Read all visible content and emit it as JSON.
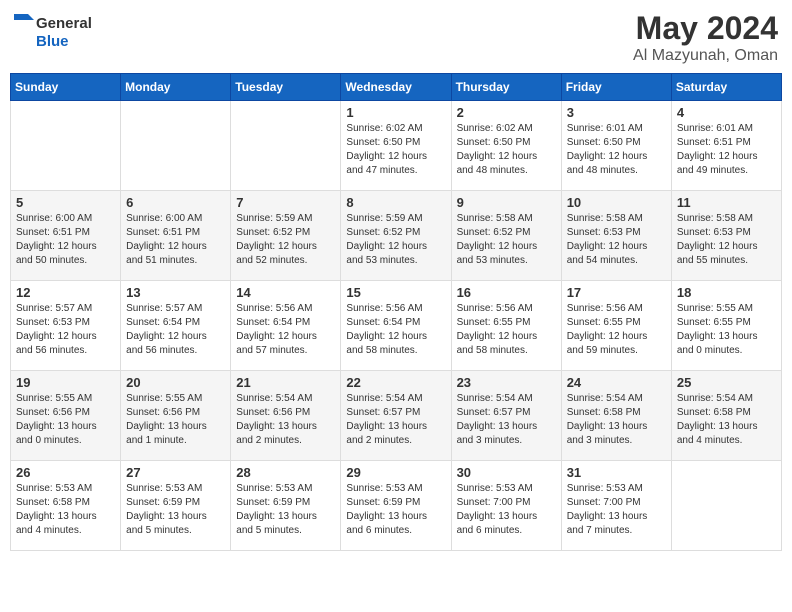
{
  "header": {
    "logo_general": "General",
    "logo_blue": "Blue",
    "title": "May 2024",
    "subtitle": "Al Mazyunah, Oman"
  },
  "days_of_week": [
    "Sunday",
    "Monday",
    "Tuesday",
    "Wednesday",
    "Thursday",
    "Friday",
    "Saturday"
  ],
  "weeks": [
    [
      {
        "day": "",
        "info": ""
      },
      {
        "day": "",
        "info": ""
      },
      {
        "day": "",
        "info": ""
      },
      {
        "day": "1",
        "info": "Sunrise: 6:02 AM\nSunset: 6:50 PM\nDaylight: 12 hours\nand 47 minutes."
      },
      {
        "day": "2",
        "info": "Sunrise: 6:02 AM\nSunset: 6:50 PM\nDaylight: 12 hours\nand 48 minutes."
      },
      {
        "day": "3",
        "info": "Sunrise: 6:01 AM\nSunset: 6:50 PM\nDaylight: 12 hours\nand 48 minutes."
      },
      {
        "day": "4",
        "info": "Sunrise: 6:01 AM\nSunset: 6:51 PM\nDaylight: 12 hours\nand 49 minutes."
      }
    ],
    [
      {
        "day": "5",
        "info": "Sunrise: 6:00 AM\nSunset: 6:51 PM\nDaylight: 12 hours\nand 50 minutes."
      },
      {
        "day": "6",
        "info": "Sunrise: 6:00 AM\nSunset: 6:51 PM\nDaylight: 12 hours\nand 51 minutes."
      },
      {
        "day": "7",
        "info": "Sunrise: 5:59 AM\nSunset: 6:52 PM\nDaylight: 12 hours\nand 52 minutes."
      },
      {
        "day": "8",
        "info": "Sunrise: 5:59 AM\nSunset: 6:52 PM\nDaylight: 12 hours\nand 53 minutes."
      },
      {
        "day": "9",
        "info": "Sunrise: 5:58 AM\nSunset: 6:52 PM\nDaylight: 12 hours\nand 53 minutes."
      },
      {
        "day": "10",
        "info": "Sunrise: 5:58 AM\nSunset: 6:53 PM\nDaylight: 12 hours\nand 54 minutes."
      },
      {
        "day": "11",
        "info": "Sunrise: 5:58 AM\nSunset: 6:53 PM\nDaylight: 12 hours\nand 55 minutes."
      }
    ],
    [
      {
        "day": "12",
        "info": "Sunrise: 5:57 AM\nSunset: 6:53 PM\nDaylight: 12 hours\nand 56 minutes."
      },
      {
        "day": "13",
        "info": "Sunrise: 5:57 AM\nSunset: 6:54 PM\nDaylight: 12 hours\nand 56 minutes."
      },
      {
        "day": "14",
        "info": "Sunrise: 5:56 AM\nSunset: 6:54 PM\nDaylight: 12 hours\nand 57 minutes."
      },
      {
        "day": "15",
        "info": "Sunrise: 5:56 AM\nSunset: 6:54 PM\nDaylight: 12 hours\nand 58 minutes."
      },
      {
        "day": "16",
        "info": "Sunrise: 5:56 AM\nSunset: 6:55 PM\nDaylight: 12 hours\nand 58 minutes."
      },
      {
        "day": "17",
        "info": "Sunrise: 5:56 AM\nSunset: 6:55 PM\nDaylight: 12 hours\nand 59 minutes."
      },
      {
        "day": "18",
        "info": "Sunrise: 5:55 AM\nSunset: 6:55 PM\nDaylight: 13 hours\nand 0 minutes."
      }
    ],
    [
      {
        "day": "19",
        "info": "Sunrise: 5:55 AM\nSunset: 6:56 PM\nDaylight: 13 hours\nand 0 minutes."
      },
      {
        "day": "20",
        "info": "Sunrise: 5:55 AM\nSunset: 6:56 PM\nDaylight: 13 hours\nand 1 minute."
      },
      {
        "day": "21",
        "info": "Sunrise: 5:54 AM\nSunset: 6:56 PM\nDaylight: 13 hours\nand 2 minutes."
      },
      {
        "day": "22",
        "info": "Sunrise: 5:54 AM\nSunset: 6:57 PM\nDaylight: 13 hours\nand 2 minutes."
      },
      {
        "day": "23",
        "info": "Sunrise: 5:54 AM\nSunset: 6:57 PM\nDaylight: 13 hours\nand 3 minutes."
      },
      {
        "day": "24",
        "info": "Sunrise: 5:54 AM\nSunset: 6:58 PM\nDaylight: 13 hours\nand 3 minutes."
      },
      {
        "day": "25",
        "info": "Sunrise: 5:54 AM\nSunset: 6:58 PM\nDaylight: 13 hours\nand 4 minutes."
      }
    ],
    [
      {
        "day": "26",
        "info": "Sunrise: 5:53 AM\nSunset: 6:58 PM\nDaylight: 13 hours\nand 4 minutes."
      },
      {
        "day": "27",
        "info": "Sunrise: 5:53 AM\nSunset: 6:59 PM\nDaylight: 13 hours\nand 5 minutes."
      },
      {
        "day": "28",
        "info": "Sunrise: 5:53 AM\nSunset: 6:59 PM\nDaylight: 13 hours\nand 5 minutes."
      },
      {
        "day": "29",
        "info": "Sunrise: 5:53 AM\nSunset: 6:59 PM\nDaylight: 13 hours\nand 6 minutes."
      },
      {
        "day": "30",
        "info": "Sunrise: 5:53 AM\nSunset: 7:00 PM\nDaylight: 13 hours\nand 6 minutes."
      },
      {
        "day": "31",
        "info": "Sunrise: 5:53 AM\nSunset: 7:00 PM\nDaylight: 13 hours\nand 7 minutes."
      },
      {
        "day": "",
        "info": ""
      }
    ]
  ]
}
